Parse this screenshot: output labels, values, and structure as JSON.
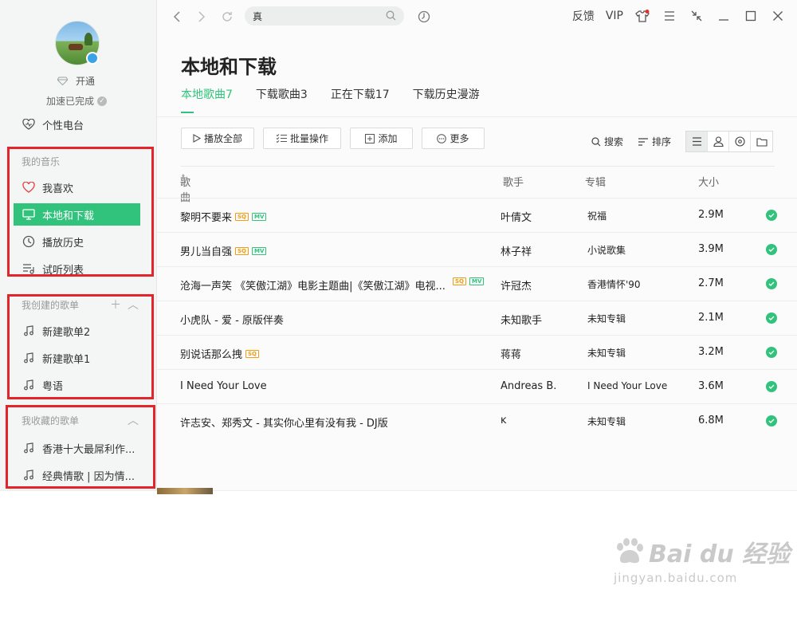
{
  "sidebar": {
    "vip_label": "开通",
    "speed_label": "加速已完成",
    "radio": "个性电台",
    "my_music_title": "我的音乐",
    "my_music": [
      "我喜欢",
      "本地和下载",
      "播放历史",
      "试听列表"
    ],
    "created_title": "我创建的歌单",
    "created": [
      "新建歌单2",
      "新建歌单1",
      "粤语"
    ],
    "collected_title": "我收藏的歌单",
    "collected": [
      "香港十大最屌利作...",
      "经典情歌 | 因为情..."
    ]
  },
  "topbar": {
    "search_value": "真",
    "feedback": "反馈",
    "vip": "VIP"
  },
  "page": {
    "title": "本地和下载",
    "tabs": [
      "本地歌曲7",
      "下载歌曲3",
      "正在下载17",
      "下载历史漫游"
    ]
  },
  "toolbar": {
    "play_all": "播放全部",
    "batch": "批量操作",
    "add": "添加",
    "more": "更多",
    "search": "搜索",
    "sort": "排序"
  },
  "table": {
    "headers": {
      "song": "歌曲",
      "singer": "歌手",
      "album": "专辑",
      "size": "大小"
    },
    "tag_sq": "SQ",
    "tag_mv": "MV",
    "rows": [
      {
        "song": "黎明不要来",
        "singer": "叶倩文",
        "album": "祝福",
        "size": "2.9M"
      },
      {
        "song": "男儿当自强",
        "singer": "林子祥",
        "album": "小说歌集",
        "size": "3.9M"
      },
      {
        "song": "沧海一声笑 《笑傲江湖》电影主题曲|《笑傲江湖》电视...",
        "singer": "许冠杰",
        "album": "香港情怀'90",
        "size": "2.7M"
      },
      {
        "song": "小虎队 - 爱 - 原版伴奏",
        "singer": "未知歌手",
        "album": "未知专辑",
        "size": "2.1M"
      },
      {
        "song": "别说话那么拽",
        "singer": "蒋蒋",
        "album": "未知专辑",
        "size": "3.2M"
      },
      {
        "song": "I Need Your Love",
        "singer": "Andreas B.",
        "album": "I Need Your Love",
        "size": "3.6M"
      },
      {
        "song": "许志安、郑秀文 - 其实你心里有没有我 - DJ版",
        "singer": "ĸ",
        "album": "未知专辑",
        "size": "6.8M"
      }
    ]
  },
  "watermark": {
    "main": "Bai du 经验",
    "sub": "jingyan.baidu.com"
  },
  "colors": {
    "accent": "#31c27c",
    "highlight_box": "#e3242b",
    "sq": "#f39c12"
  }
}
